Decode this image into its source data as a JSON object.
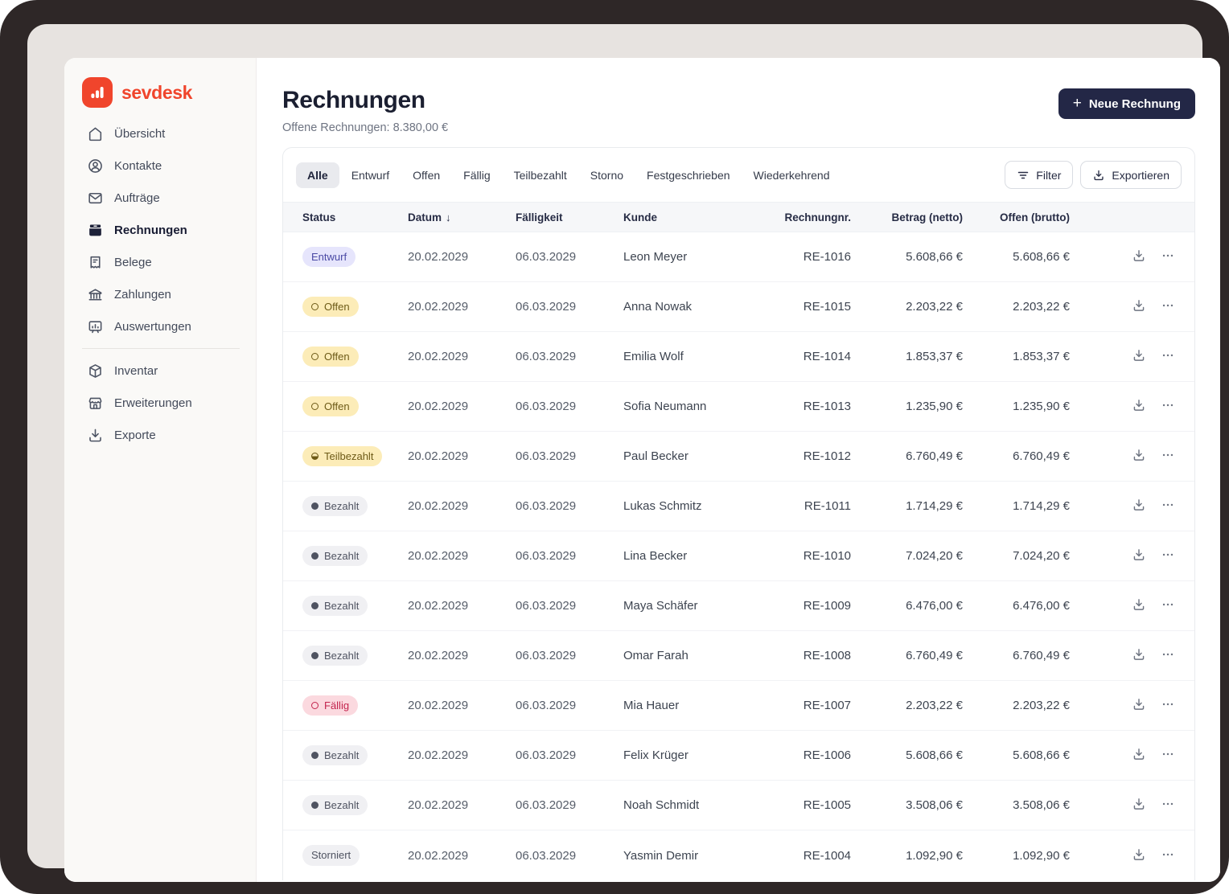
{
  "brand": {
    "name": "sevdesk"
  },
  "sidebar": {
    "primary_items": [
      {
        "label": "Übersicht",
        "icon": "home-icon",
        "active": false
      },
      {
        "label": "Kontakte",
        "icon": "contacts-icon",
        "active": false
      },
      {
        "label": "Aufträge",
        "icon": "mail-icon",
        "active": false
      },
      {
        "label": "Rechnungen",
        "icon": "invoices-icon",
        "active": true
      },
      {
        "label": "Belege",
        "icon": "receipt-icon",
        "active": false
      },
      {
        "label": "Zahlungen",
        "icon": "bank-icon",
        "active": false
      },
      {
        "label": "Auswertungen",
        "icon": "chart-board-icon",
        "active": false
      }
    ],
    "secondary_items": [
      {
        "label": "Inventar",
        "icon": "cube-icon",
        "active": false
      },
      {
        "label": "Erweiterungen",
        "icon": "store-icon",
        "active": false
      },
      {
        "label": "Exporte",
        "icon": "export-icon",
        "active": false
      }
    ]
  },
  "header": {
    "title": "Rechnungen",
    "subtitle": "Offene Rechnungen: 8.380,00 €",
    "new_invoice_label": "Neue Rechnung",
    "plus_glyph": "+"
  },
  "tabs": {
    "items": [
      "Alle",
      "Entwurf",
      "Offen",
      "Fällig",
      "Teilbezahlt",
      "Storno",
      "Festgeschrieben",
      "Wiederkehrend"
    ],
    "active": "Alle"
  },
  "toolbar": {
    "filter_label": "Filter",
    "export_label": "Exportieren"
  },
  "table": {
    "columns": [
      "Status",
      "Datum",
      "Fälligkeit",
      "Kunde",
      "Rechnungnr.",
      "Betrag (netto)",
      "Offen (brutto)"
    ],
    "sorted_by": "Datum",
    "sort_direction": "desc",
    "sort_glyph": "↓",
    "rows": [
      {
        "status": "Entwurf",
        "status_type": "draft",
        "date": "20.02.2029",
        "due": "06.03.2029",
        "customer": "Leon Meyer",
        "number": "RE-1016",
        "net": "5.608,66 €",
        "open": "5.608,66 €"
      },
      {
        "status": "Offen",
        "status_type": "open",
        "date": "20.02.2029",
        "due": "06.03.2029",
        "customer": "Anna Nowak",
        "number": "RE-1015",
        "net": "2.203,22 €",
        "open": "2.203,22 €"
      },
      {
        "status": "Offen",
        "status_type": "open",
        "date": "20.02.2029",
        "due": "06.03.2029",
        "customer": "Emilia Wolf",
        "number": "RE-1014",
        "net": "1.853,37 €",
        "open": "1.853,37 €"
      },
      {
        "status": "Offen",
        "status_type": "open",
        "date": "20.02.2029",
        "due": "06.03.2029",
        "customer": "Sofia Neumann",
        "number": "RE-1013",
        "net": "1.235,90 €",
        "open": "1.235,90 €"
      },
      {
        "status": "Teilbezahlt",
        "status_type": "partial",
        "date": "20.02.2029",
        "due": "06.03.2029",
        "customer": "Paul Becker",
        "number": "RE-1012",
        "net": "6.760,49 €",
        "open": "6.760,49 €"
      },
      {
        "status": "Bezahlt",
        "status_type": "paid",
        "date": "20.02.2029",
        "due": "06.03.2029",
        "customer": "Lukas Schmitz",
        "number": "RE-1011",
        "net": "1.714,29 €",
        "open": "1.714,29 €"
      },
      {
        "status": "Bezahlt",
        "status_type": "paid",
        "date": "20.02.2029",
        "due": "06.03.2029",
        "customer": "Lina Becker",
        "number": "RE-1010",
        "net": "7.024,20 €",
        "open": "7.024,20 €"
      },
      {
        "status": "Bezahlt",
        "status_type": "paid",
        "date": "20.02.2029",
        "due": "06.03.2029",
        "customer": "Maya Schäfer",
        "number": "RE-1009",
        "net": "6.476,00 €",
        "open": "6.476,00 €"
      },
      {
        "status": "Bezahlt",
        "status_type": "paid",
        "date": "20.02.2029",
        "due": "06.03.2029",
        "customer": "Omar Farah",
        "number": "RE-1008",
        "net": "6.760,49 €",
        "open": "6.760,49 €"
      },
      {
        "status": "Fällig",
        "status_type": "due",
        "date": "20.02.2029",
        "due": "06.03.2029",
        "customer": "Mia Hauer",
        "number": "RE-1007",
        "net": "2.203,22 €",
        "open": "2.203,22 €"
      },
      {
        "status": "Bezahlt",
        "status_type": "paid",
        "date": "20.02.2029",
        "due": "06.03.2029",
        "customer": "Felix Krüger",
        "number": "RE-1006",
        "net": "5.608,66 €",
        "open": "5.608,66 €"
      },
      {
        "status": "Bezahlt",
        "status_type": "paid",
        "date": "20.02.2029",
        "due": "06.03.2029",
        "customer": "Noah Schmidt",
        "number": "RE-1005",
        "net": "3.508,06 €",
        "open": "3.508,06 €"
      },
      {
        "status": "Storniert",
        "status_type": "cancelled",
        "date": "20.02.2029",
        "due": "06.03.2029",
        "customer": "Yasmin Demir",
        "number": "RE-1004",
        "net": "1.092,90 €",
        "open": "1.092,90 €"
      }
    ]
  },
  "colors": {
    "brand_red": "#f0452c",
    "primary_button_bg": "#232746",
    "badge_draft_bg": "#e6e5fc",
    "badge_draft_text": "#4b4aa5",
    "badge_open_bg": "#fcecb8",
    "badge_open_text": "#6d5a17",
    "badge_due_bg": "#fbd9df",
    "badge_due_text": "#c3254e",
    "badge_neutral_bg": "#f0f0f3",
    "badge_neutral_text": "#4f5361"
  }
}
